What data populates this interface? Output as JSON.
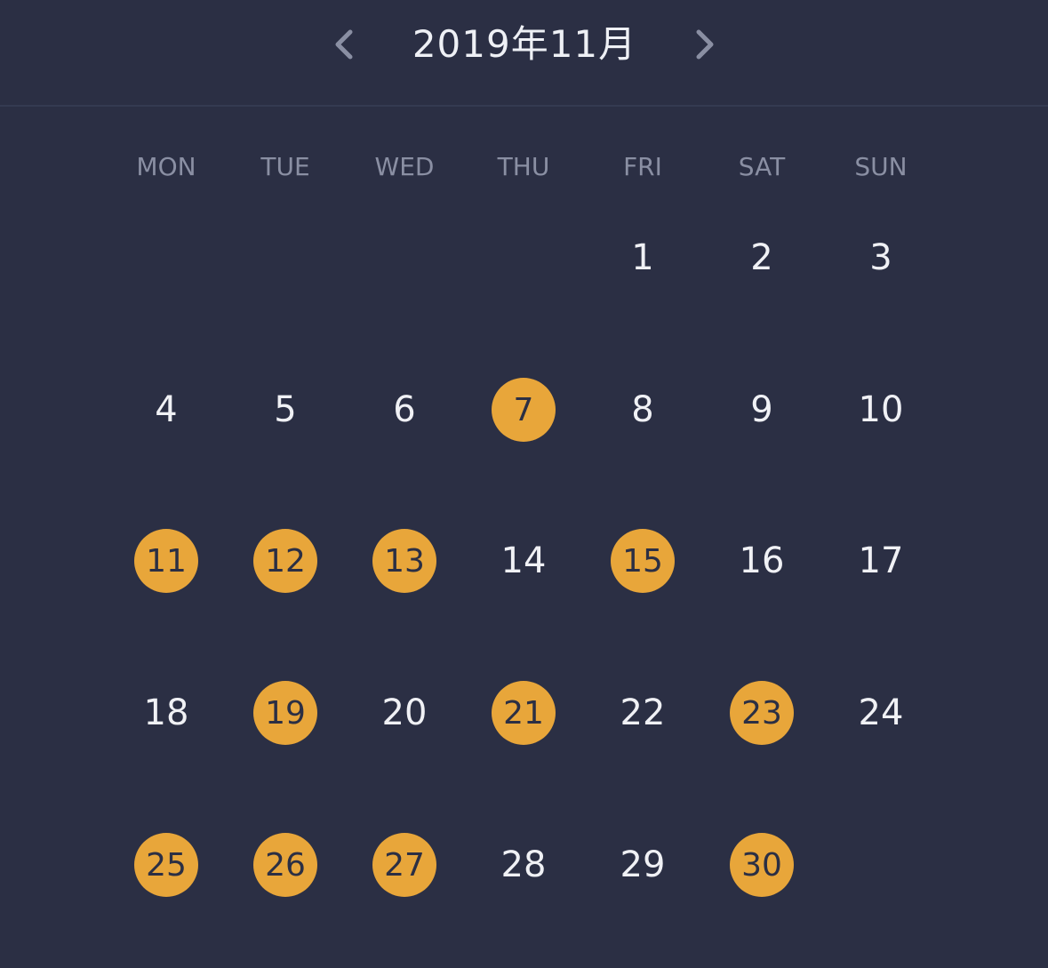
{
  "header": {
    "title": "2019年11月",
    "prev_icon": "chevron-left-icon",
    "next_icon": "chevron-right-icon"
  },
  "weekdays": [
    "MON",
    "TUE",
    "WED",
    "THU",
    "FRI",
    "SAT",
    "SUN"
  ],
  "first_weekday_index": 4,
  "days_in_month": 30,
  "marked_days": [
    7,
    11,
    12,
    13,
    15,
    19,
    21,
    23,
    25,
    26,
    27,
    30
  ],
  "colors": {
    "background": "#2b2f44",
    "accent": "#e8a63a",
    "text": "#f0f1f5",
    "muted": "#8a8fa3"
  }
}
